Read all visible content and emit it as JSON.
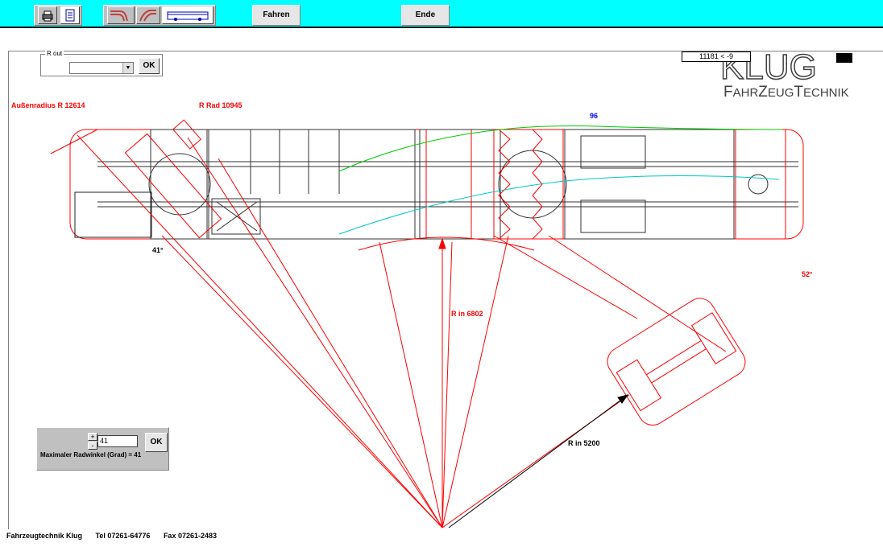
{
  "toolbar": {
    "print_icon": "printer-icon",
    "doc_icon": "document-icon",
    "curve_icon_1": "s-curve-icon",
    "curve_icon_2": "diagonal-curve-icon",
    "bus_icon": "bus-icon",
    "drive_label": "Fahren",
    "end_label": "Ende"
  },
  "r_out": {
    "legend": "R out",
    "selected": "",
    "ok_label": "OK"
  },
  "logo": {
    "coord_text": "11181 < -9",
    "brand_top": "KLUG",
    "brand_bottom_parts": [
      "F",
      "AHR",
      "Z",
      "EUG",
      "T",
      "ECHNIK"
    ]
  },
  "labels": {
    "outer_radius": "Außenradius R  12614",
    "r_rad": "R Rad 10945",
    "top_marker": "96",
    "left_angle": "41°",
    "right_angle": "52°",
    "r_in_main": "R in 6802",
    "r_in_trailer": "R in  5200"
  },
  "angle_panel": {
    "plus_label": "+",
    "minus_label": "-",
    "value": "41",
    "ok_label": "OK",
    "text": "Maximaler Radwinkel  (Grad) = 41"
  },
  "status": {
    "company": "Fahrzeugtechnik Klug",
    "tel": "Tel 07261-64776",
    "fax": "Fax 07261-2483"
  },
  "colors": {
    "toolbar_bg": "#00ffff",
    "drawing_red": "#ff0000",
    "drawing_green": "#00cc00",
    "drawing_cyan": "#00c8c8",
    "label_blue": "#0000ff"
  }
}
